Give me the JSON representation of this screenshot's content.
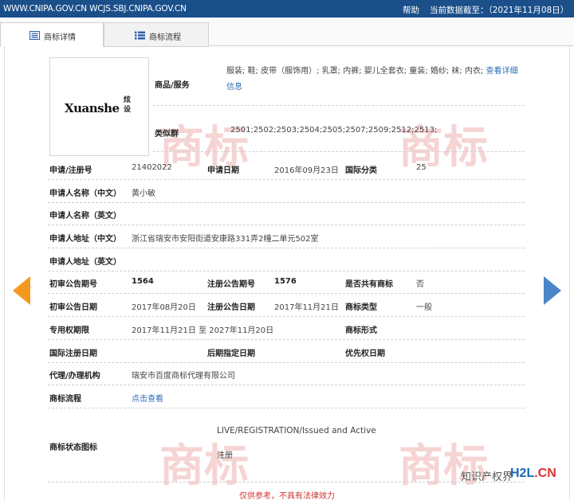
{
  "topbar": {
    "host": "WWW.CNIPA.GOV.CN WCJS.SBJ.CNIPA.GOV.CN",
    "help": "帮助",
    "data_date": "当前数据截至：（2021年11月08日）"
  },
  "tabs": [
    {
      "label": "商标详情",
      "icon": "list-detail-icon",
      "active": true
    },
    {
      "label": "商标流程",
      "icon": "list-icon",
      "active": false
    }
  ],
  "logo": {
    "text": "Xuanshe",
    "cn": "炫设"
  },
  "goods": {
    "label": "商品/服务",
    "value": "服装; 鞋; 皮带（服饰用）; 乳罩; 内裤; 婴儿全套衣; 童装; 婚纱; 袜; 内衣;",
    "more_link": "查看详细信息"
  },
  "similar_group": {
    "label": "类似群",
    "value": "2501;2502;2503;2504;2505;2507;2509;2512;2513;"
  },
  "fields": {
    "reg_no_label": "申请/注册号",
    "reg_no": "21402022",
    "apply_date_label": "申请日期",
    "apply_date": "2016年09月23日",
    "intl_class_label": "国际分类",
    "intl_class": "25",
    "applicant_cn_label": "申请人名称（中文）",
    "applicant_cn": "黄小敏",
    "applicant_en_label": "申请人名称（英文）",
    "applicant_en": "",
    "address_cn_label": "申请人地址（中文）",
    "address_cn": "浙江省瑞安市安阳街道安康路331弄2幢二单元502室",
    "address_en_label": "申请人地址（英文）",
    "address_en": "",
    "prelim_no_label": "初审公告期号",
    "prelim_no": "1564",
    "reg_pub_no_label": "注册公告期号",
    "reg_pub_no": "1576",
    "shared_label": "是否共有商标",
    "shared": "否",
    "prelim_date_label": "初审公告日期",
    "prelim_date": "2017年08月20日",
    "reg_pub_date_label": "注册公告日期",
    "reg_pub_date": "2017年11月21日",
    "tm_type_label": "商标类型",
    "tm_type": "一般",
    "exclusive_label": "专用权期限",
    "exclusive": "2017年11月21日 至 2027年11月20日",
    "tm_form_label": "商标形式",
    "tm_form": "",
    "intl_reg_date_label": "国际注册日期",
    "intl_reg_date": "",
    "later_date_label": "后期指定日期",
    "later_date": "",
    "priority_label": "优先权日期",
    "priority": "",
    "agent_label": "代理/办理机构",
    "agent": "瑞安市百度商标代理有限公司",
    "flow_label": "商标流程",
    "flow_link": "点击查看",
    "status_label": "商标状态图标",
    "status_en": "LIVE/REGISTRATION/Issued and Active",
    "status_cn": "注册"
  },
  "disclaimer": "仅供参考，不具有法律效力",
  "brand": {
    "text": "知识产权界",
    "site_a": "H2L",
    "site_b": ".CN"
  },
  "watermark": "商标",
  "colors": {
    "topbar": "#1a4f8a",
    "link": "#2e6db4",
    "prev_arrow": "#f39a1e",
    "next_arrow": "#4a86c8",
    "disclaimer": "#d03030"
  }
}
